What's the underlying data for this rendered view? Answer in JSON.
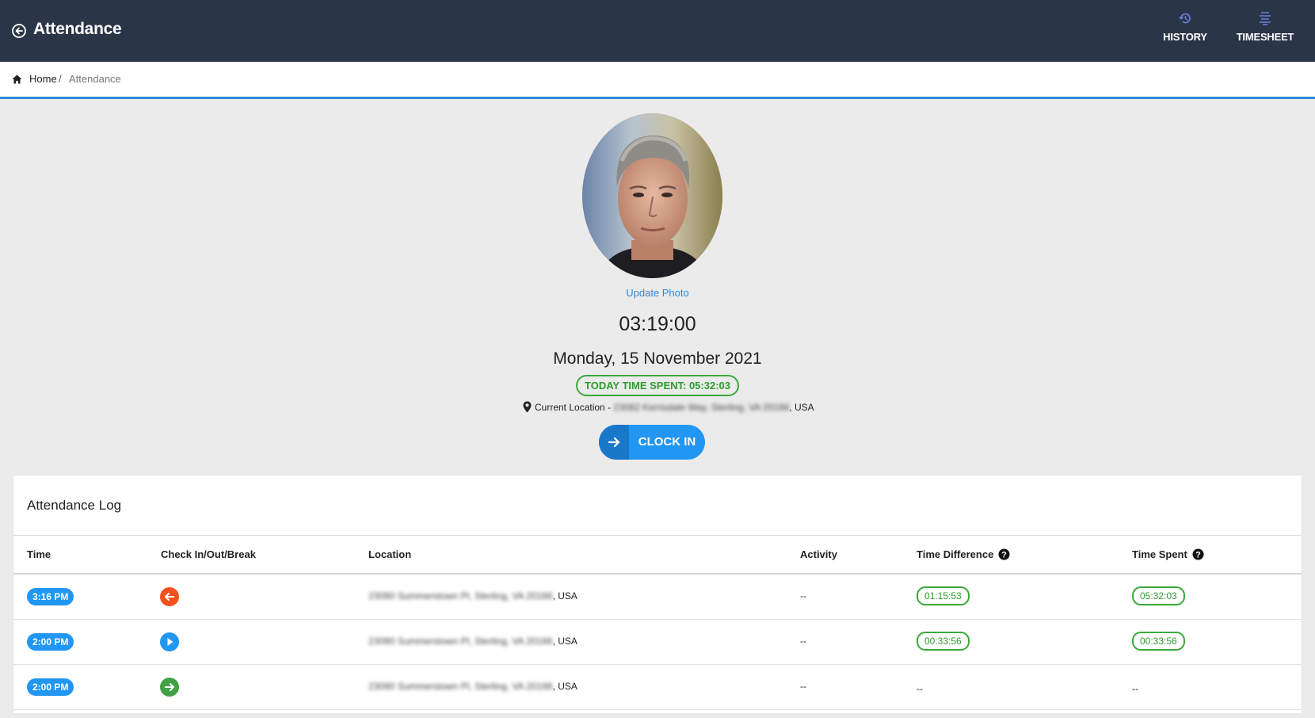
{
  "header": {
    "title": "Attendance",
    "nav": [
      {
        "label": "HISTORY",
        "icon": "history-icon"
      },
      {
        "label": "TIMESHEET",
        "icon": "timesheet-icon"
      }
    ],
    "colors": {
      "bar": "#2b3548",
      "accent": "#2f88d6"
    }
  },
  "breadcrumb": {
    "home": "Home",
    "separator": "/",
    "current": "Attendance"
  },
  "profile": {
    "update_photo": "Update Photo",
    "clock": "03:19:00",
    "date": "Monday, 15 November 2021",
    "time_spent": "TODAY TIME SPENT: 05:32:03",
    "location_label": "Current Location -",
    "location_address": "23082 Kerrisdale Way, Sterling, VA 20166",
    "location_suffix": ", USA",
    "clock_in_label": "CLOCK IN"
  },
  "log": {
    "title": "Attendance Log",
    "columns": {
      "time": "Time",
      "type": "Check In/Out/Break",
      "location": "Location",
      "activity": "Activity",
      "time_difference": "Time Difference",
      "time_spent": "Time Spent"
    },
    "rows": [
      {
        "time": "3:16 PM",
        "type_icon": "check-out-icon",
        "type_color": "#f4511e",
        "location_blurred": "23090 Summerstown Pl, Sterling, VA 20166",
        "location_suffix": ", USA",
        "activity": "--",
        "time_difference": "01:15:53",
        "time_spent": "05:32:03"
      },
      {
        "time": "2:00 PM",
        "type_icon": "break-play-icon",
        "type_color": "#2196f3",
        "location_blurred": "23090 Summerstown Pl, Sterling, VA 20166",
        "location_suffix": ", USA",
        "activity": "--",
        "time_difference": "00:33:56",
        "time_spent": "00:33:56"
      },
      {
        "time": "2:00 PM",
        "type_icon": "check-in-icon",
        "type_color": "#43a047",
        "location_blurred": "23090 Summerstown Pl, Sterling, VA 20166",
        "location_suffix": ", USA",
        "activity": "--",
        "time_difference": "--",
        "time_spent": "--"
      }
    ]
  }
}
